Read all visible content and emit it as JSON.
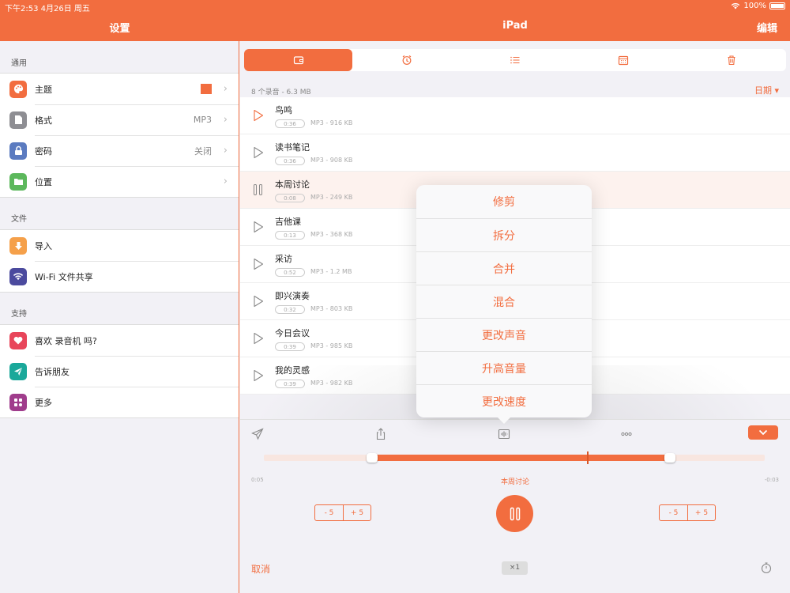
{
  "status": {
    "time": "下午2:53   4月26日 周五",
    "battery": "100%"
  },
  "nav": {
    "left_title": "设置",
    "center_title": "iPad",
    "edit_label": "编辑"
  },
  "sidebar": {
    "sections": [
      {
        "header": "通用",
        "items": [
          {
            "label": "主题",
            "icon": "palette-icon",
            "color": "#f26d3f",
            "value": ""
          },
          {
            "label": "格式",
            "icon": "file-icon",
            "color": "#8e8e93",
            "value": "MP3"
          },
          {
            "label": "密码",
            "icon": "lock-icon",
            "color": "#5b7bc0",
            "value": "关闭"
          },
          {
            "label": "位置",
            "icon": "folder-icon",
            "color": "#5cb85c",
            "value": ""
          }
        ]
      },
      {
        "header": "文件",
        "items": [
          {
            "label": "导入",
            "icon": "download-icon",
            "color": "#f5a04a"
          },
          {
            "label": "Wi-Fi 文件共享",
            "icon": "wifi-icon",
            "color": "#4b4a9e"
          }
        ]
      },
      {
        "header": "支持",
        "items": [
          {
            "label": "喜欢 录音机 吗?",
            "icon": "heart-icon",
            "color": "#e8455a"
          },
          {
            "label": "告诉朋友",
            "icon": "send-icon",
            "color": "#1aa89a"
          },
          {
            "label": "更多",
            "icon": "apps-icon",
            "color": "#a03d8c"
          }
        ]
      }
    ]
  },
  "main": {
    "info": {
      "count": "8 个录音 - 6.3 MB",
      "sort": "日期 ▾"
    },
    "recordings": [
      {
        "title": "鸟鸣",
        "duration": "0:36",
        "meta": "MP3 - 916 KB",
        "playing": false
      },
      {
        "title": "读书笔记",
        "duration": "0:36",
        "meta": "MP3 - 908 KB",
        "playing": false
      },
      {
        "title": "本周讨论",
        "duration": "0:08",
        "meta": "MP3 - 249 KB",
        "playing": true
      },
      {
        "title": "吉他课",
        "duration": "0:13",
        "meta": "MP3 - 368 KB",
        "playing": false
      },
      {
        "title": "采访",
        "duration": "0:52",
        "meta": "MP3 - 1.2 MB",
        "playing": false
      },
      {
        "title": "即兴演奏",
        "duration": "0:32",
        "meta": "MP3 - 803 KB",
        "playing": false
      },
      {
        "title": "今日会议",
        "duration": "0:39",
        "meta": "MP3 - 985 KB",
        "playing": false
      },
      {
        "title": "我的灵感",
        "duration": "0:39",
        "meta": "MP3 - 982 KB",
        "playing": false
      }
    ]
  },
  "popover": {
    "items": [
      "修剪",
      "拆分",
      "合并",
      "混合",
      "更改声音",
      "升高音量",
      "更改速度"
    ]
  },
  "player": {
    "time_elapsed": "0:05",
    "time_remaining": "-0:03",
    "track_name": "本周讨论",
    "skip_minus": "- 5",
    "skip_plus": "+ 5",
    "cancel_label": "取消",
    "speed_label": "×1",
    "selection_start": 0.205,
    "selection_end": 0.81,
    "playhead": 0.645
  },
  "colors": {
    "accent": "#f26d3f"
  }
}
